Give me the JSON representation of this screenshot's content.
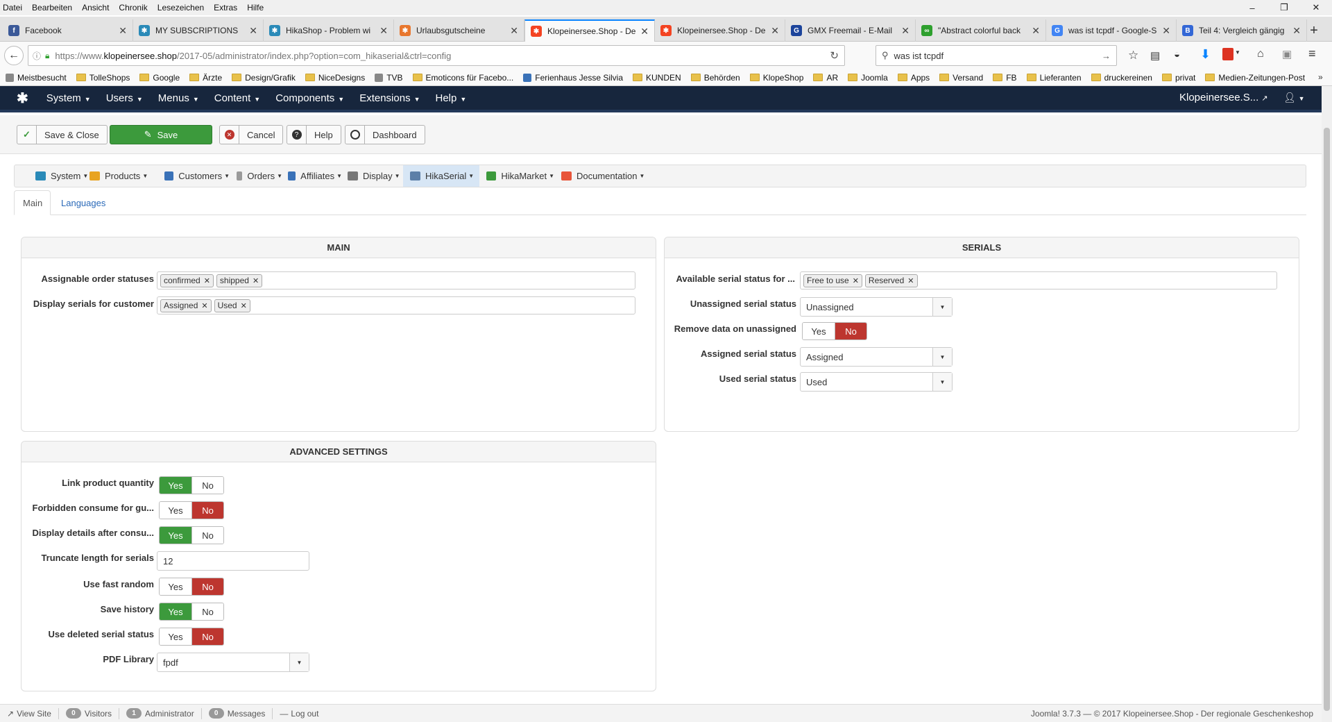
{
  "browser_menu": [
    "Datei",
    "Bearbeiten",
    "Ansicht",
    "Chronik",
    "Lesezeichen",
    "Extras",
    "Hilfe"
  ],
  "window_controls": {
    "minimize": "–",
    "restore": "❐",
    "close": "✕"
  },
  "tabs": [
    {
      "title": "Facebook",
      "icon_color": "#3b5998",
      "icon_glyph": "f"
    },
    {
      "title": "MY SUBSCRIPTIONS",
      "icon_color": "#2a8ab8",
      "icon_glyph": "✱"
    },
    {
      "title": "HikaShop - Problem wi",
      "icon_color": "#2a8ab8",
      "icon_glyph": "✱"
    },
    {
      "title": "Urlaubsgutscheine",
      "icon_color": "#e8772e",
      "icon_glyph": "✱"
    },
    {
      "title": "Klopeinersee.Shop - De",
      "icon_color": "#f44321",
      "icon_glyph": "✱"
    },
    {
      "title": "Klopeinersee.Shop - De",
      "icon_color": "#f44321",
      "icon_glyph": "✱"
    },
    {
      "title": "GMX Freemail - E-Mail",
      "icon_color": "#1c449b",
      "icon_glyph": "G"
    },
    {
      "title": "\"Abstract colorful back",
      "icon_color": "#2ea02e",
      "icon_glyph": "∞"
    },
    {
      "title": "was ist tcpdf - Google-S",
      "icon_color": "#4285f4",
      "icon_glyph": "G"
    },
    {
      "title": "Teil 4: Vergleich gängig",
      "icon_color": "#3367d6",
      "icon_glyph": "B"
    }
  ],
  "active_tab": 4,
  "url_parts": {
    "prefix": "https://www.",
    "domain": "klopeinersee.shop",
    "path": "/2017-05/administrator/index.php?option=com_hikaserial&ctrl=config"
  },
  "search_value": "was ist tcpdf",
  "bookmarks": [
    "Meistbesucht",
    "TolleShops",
    "Google",
    "Ärzte",
    "Design/Grafik",
    "NiceDesigns",
    "TVB",
    "Emoticons für Facebo...",
    "Ferienhaus Jesse Silvia",
    "KUNDEN",
    "Behörden",
    "KlopeShop",
    "AR",
    "Joomla",
    "Apps",
    "Versand",
    "FB",
    "Lieferanten",
    "druckereinen",
    "privat",
    "Medien-Zeitungen-Post"
  ],
  "joomla_menu": [
    "System",
    "Users",
    "Menus",
    "Content",
    "Components",
    "Extensions",
    "Help"
  ],
  "joomla_site": "Klopeinersee.S...",
  "toolbar": {
    "save_close": "Save & Close",
    "save": "Save",
    "cancel": "Cancel",
    "help": "Help",
    "dashboard": "Dashboard"
  },
  "hika_menu": [
    {
      "label": "System",
      "color": "#2a8ab8"
    },
    {
      "label": "Products",
      "color": "#e8a321"
    },
    {
      "label": "Customers",
      "color": "#3a72b8"
    },
    {
      "label": "Orders",
      "color": "#9a9a9a"
    },
    {
      "label": "Affiliates",
      "color": "#3a72b8"
    },
    {
      "label": "Display",
      "color": "#777777"
    },
    {
      "label": "HikaSerial",
      "color": "#5c7fa8"
    },
    {
      "label": "HikaMarket",
      "color": "#3c9a3c"
    },
    {
      "label": "Documentation",
      "color": "#e8553a"
    }
  ],
  "subtabs": {
    "main": "Main",
    "languages": "Languages"
  },
  "main_panel": {
    "title": "MAIN",
    "assignable_label": "Assignable order statuses",
    "assignable_tags": [
      "confirmed",
      "shipped"
    ],
    "display_label": "Display serials for customer",
    "display_tags": [
      "Assigned",
      "Used"
    ]
  },
  "serials_panel": {
    "title": "SERIALS",
    "available_label": "Available serial status for ...",
    "available_tags": [
      "Free to use",
      "Reserved"
    ],
    "unassigned_label": "Unassigned serial status",
    "unassigned_value": "Unassigned",
    "remove_label": "Remove data on unassigned",
    "remove_value": "No",
    "assigned_label": "Assigned serial status",
    "assigned_value": "Assigned",
    "used_label": "Used serial status",
    "used_value": "Used"
  },
  "advanced_panel": {
    "title": "ADVANCED SETTINGS",
    "link_qty_label": "Link product quantity",
    "link_qty": "Yes",
    "forbidden_label": "Forbidden consume for gu...",
    "forbidden": "No",
    "display_details_label": "Display details after consu...",
    "display_details": "Yes",
    "truncate_label": "Truncate length for serials",
    "truncate_value": "12",
    "fast_random_label": "Use fast random",
    "fast_random": "No",
    "save_history_label": "Save history",
    "save_history": "Yes",
    "deleted_status_label": "Use deleted serial status",
    "deleted_status": "No",
    "pdf_label": "PDF Library",
    "pdf_value": "fpdf"
  },
  "yes_label": "Yes",
  "no_label": "No",
  "status_bar": {
    "view_site": "View Site",
    "visitors_count": "0",
    "visitors": "Visitors",
    "admin_count": "1",
    "admin": "Administrator",
    "messages_count": "0",
    "messages": "Messages",
    "logout": "Log out",
    "footer": "Joomla! 3.7.3 — © 2017 Klopeinersee.Shop - Der regionale Geschenkeshop"
  }
}
